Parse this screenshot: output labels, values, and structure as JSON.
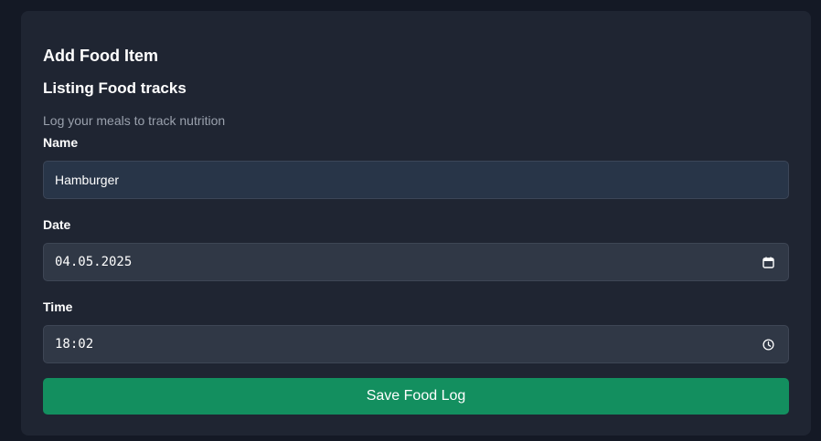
{
  "card": {
    "title": "Add Food Item",
    "subtitle": "Listing Food tracks",
    "description": "Log your meals to track nutrition"
  },
  "form": {
    "name": {
      "label": "Name",
      "value": "Hamburger"
    },
    "date": {
      "label": "Date",
      "value": "04.05.2025",
      "icon": "calendar-icon"
    },
    "time": {
      "label": "Time",
      "value": "18:02",
      "icon": "clock-icon"
    },
    "submit_label": "Save Food Log"
  },
  "colors": {
    "page_background": "#141925",
    "card_background": "#1f2532",
    "input_background": "#303846",
    "accent": "#138f5f"
  }
}
